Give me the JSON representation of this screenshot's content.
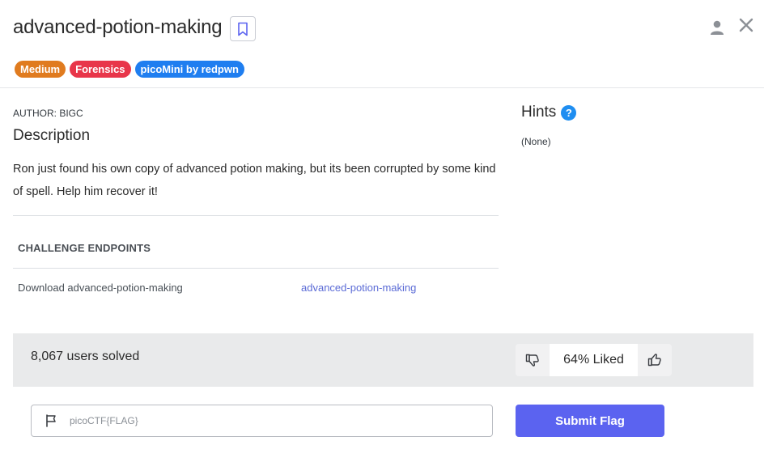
{
  "header": {
    "title": "advanced-potion-making",
    "tags": [
      {
        "label": "Medium",
        "color": "#e07b1f"
      },
      {
        "label": "Forensics",
        "color": "#e8364a"
      },
      {
        "label": "picoMini by redpwn",
        "color": "#1f7ef0"
      }
    ],
    "icons": {
      "bookmark": "bookmark-icon",
      "user": "user-icon",
      "close": "close-icon"
    }
  },
  "challenge": {
    "author": "AUTHOR: BIGC",
    "description_heading": "Description",
    "description": "Ron just found his own copy of advanced potion making, but its been corrupted by some kind of spell. Help him recover it!",
    "endpoints_heading": "CHALLENGE ENDPOINTS",
    "endpoints": [
      {
        "label": "Download advanced-potion-making",
        "link_text": "advanced-potion-making"
      }
    ]
  },
  "hints": {
    "heading": "Hints",
    "help_icon": "?",
    "text": "(None)"
  },
  "stats": {
    "solved": "8,067 users solved",
    "liked": "64% Liked",
    "liked_percent": 64
  },
  "flag": {
    "placeholder": "picoCTF{FLAG}",
    "value": "",
    "submit_label": "Submit Flag"
  },
  "colors": {
    "accent": "#5b63f0",
    "link": "#5b6bd6",
    "help": "#1f8ef1"
  }
}
